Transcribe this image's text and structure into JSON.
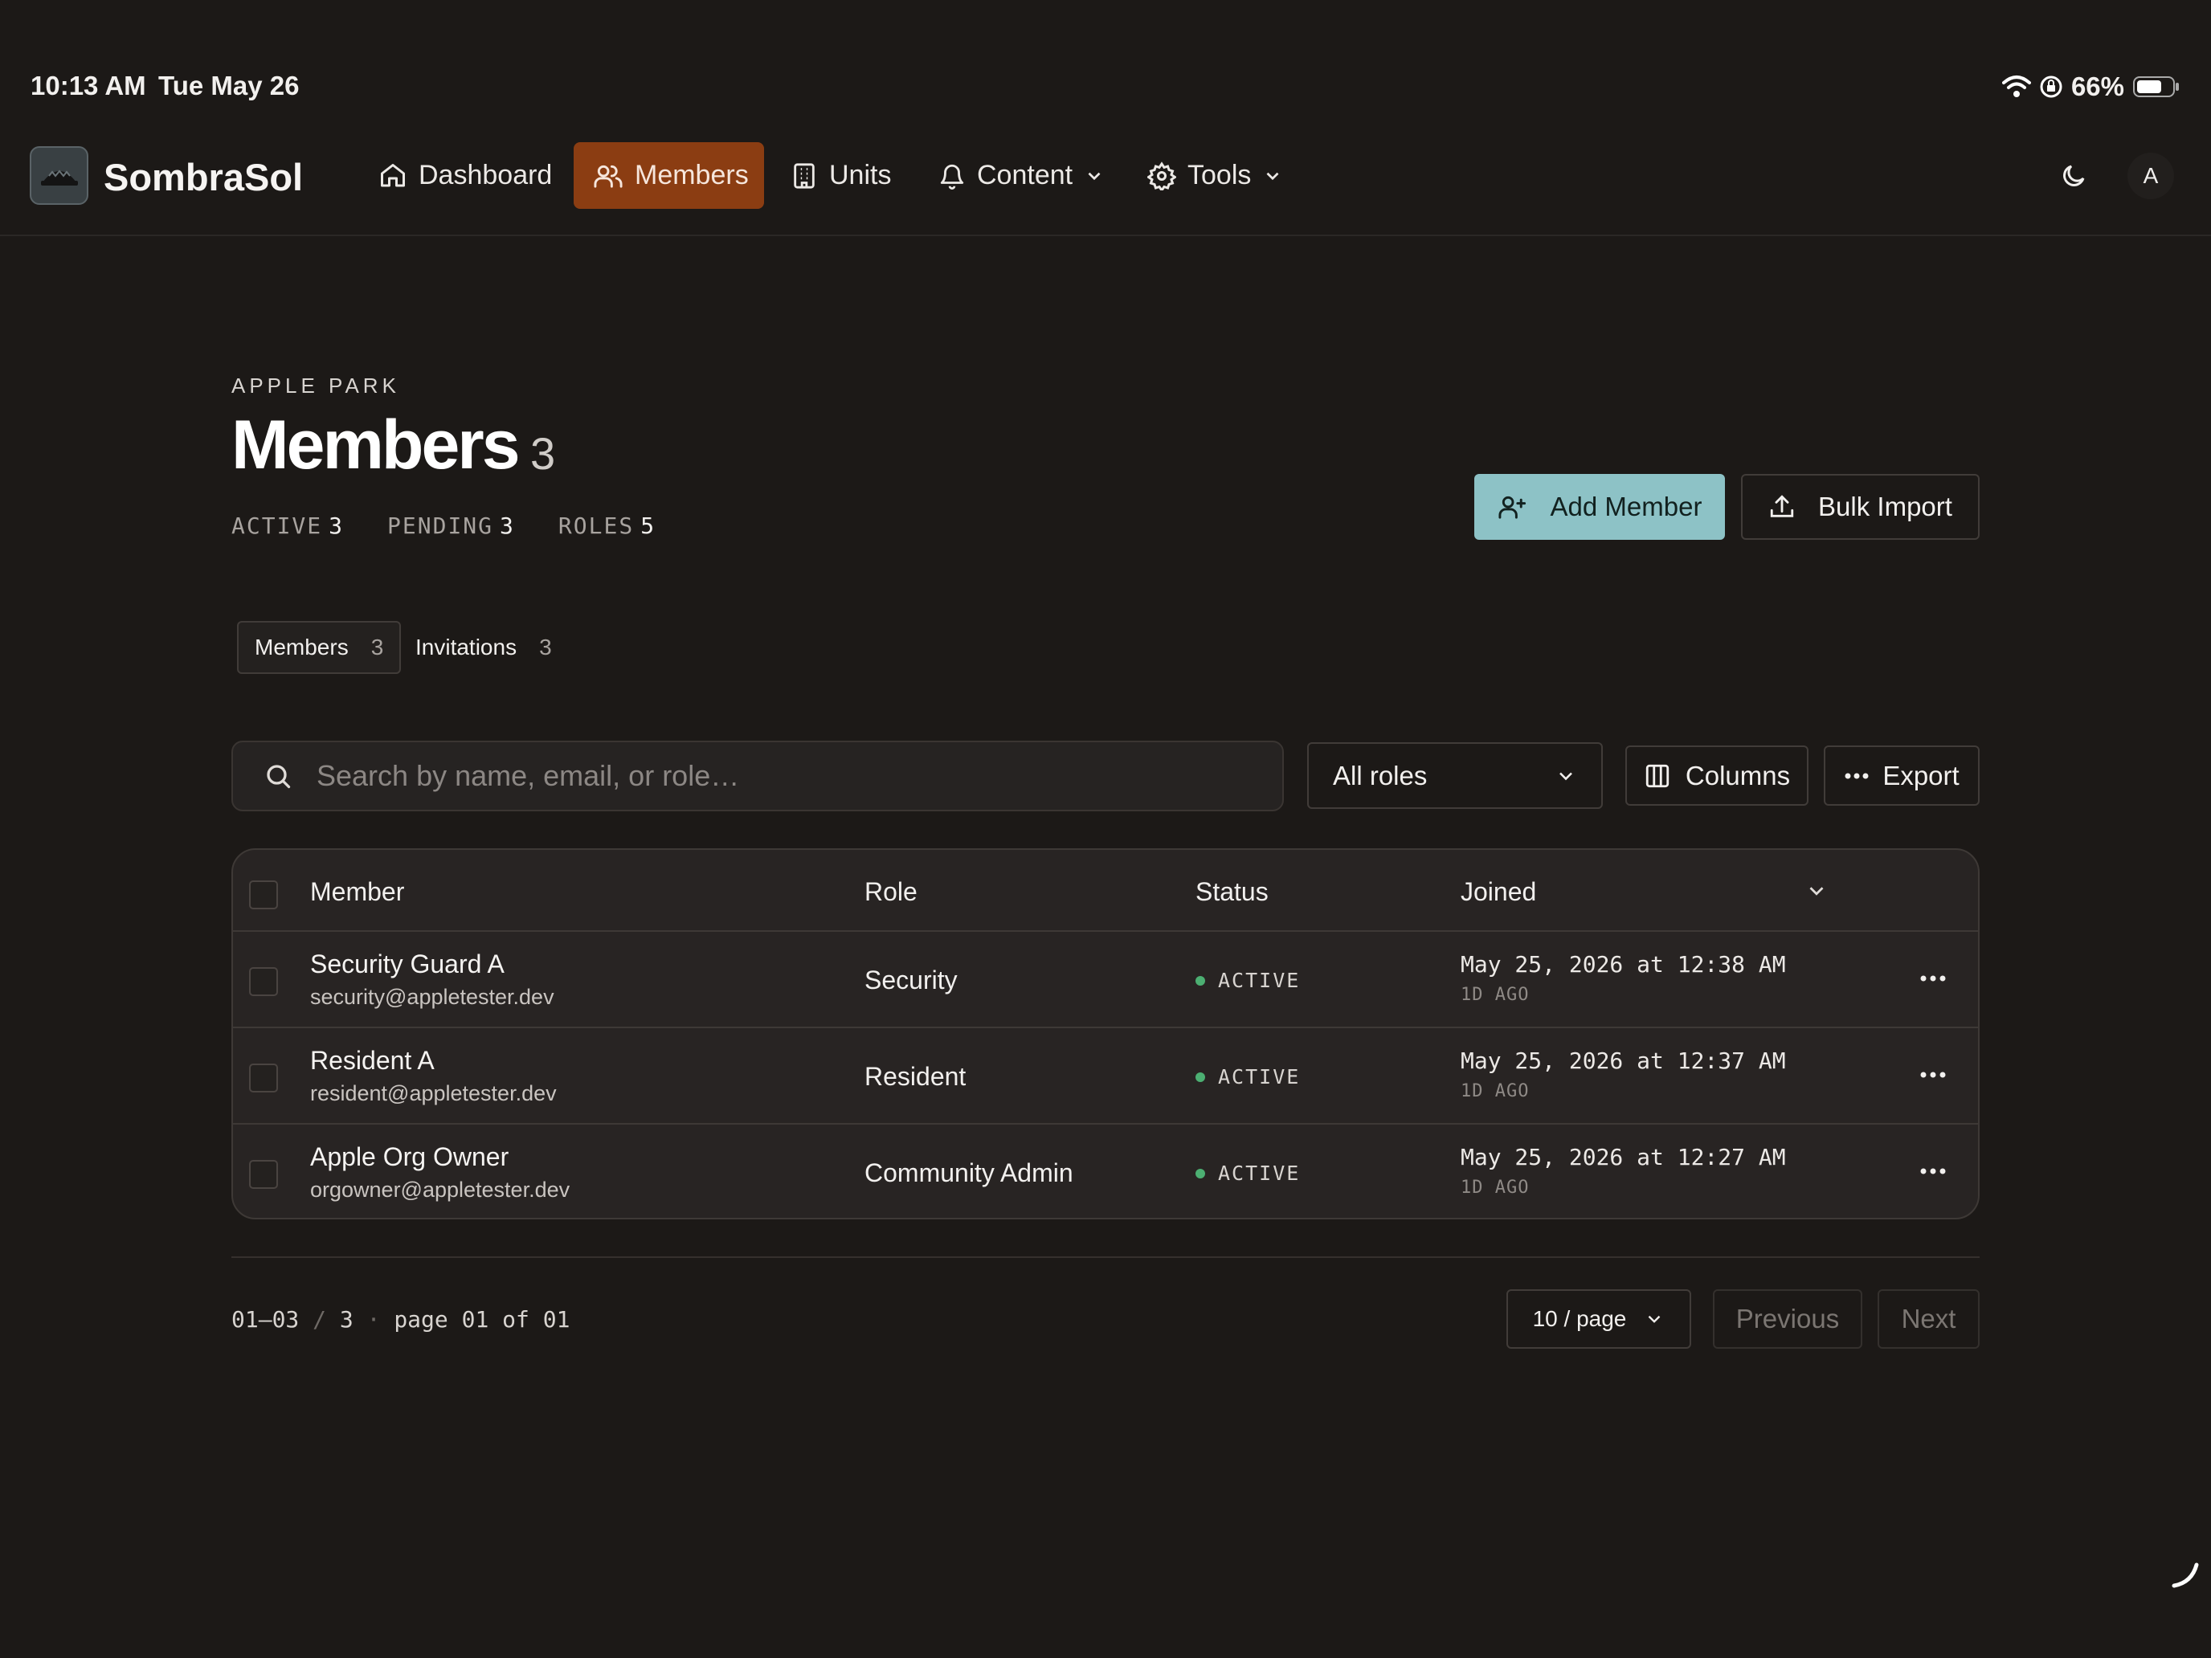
{
  "status_bar": {
    "time": "10:13 AM",
    "date": "Tue May 26",
    "battery": "66%"
  },
  "nav": {
    "brand": "SombraSol",
    "items": [
      {
        "label": "Dashboard",
        "icon": "home-icon"
      },
      {
        "label": "Members",
        "icon": "users-icon",
        "active": true
      },
      {
        "label": "Units",
        "icon": "building-icon"
      },
      {
        "label": "Content",
        "icon": "bell-icon",
        "has_dropdown": true
      },
      {
        "label": "Tools",
        "icon": "gear-icon",
        "has_dropdown": true
      }
    ],
    "avatar_initial": "A"
  },
  "header": {
    "eyebrow": "APPLE PARK",
    "title": "Members",
    "count": "3",
    "stats": [
      {
        "label": "ACTIVE",
        "value": "3"
      },
      {
        "label": "PENDING",
        "value": "3"
      },
      {
        "label": "ROLES",
        "value": "5"
      }
    ],
    "add_member_label": "Add Member",
    "bulk_import_label": "Bulk Import"
  },
  "tabs": [
    {
      "label": "Members",
      "count": "3",
      "active": true
    },
    {
      "label": "Invitations",
      "count": "3"
    }
  ],
  "toolbar": {
    "search_placeholder": "Search by name, email, or role…",
    "role_filter": "All roles",
    "columns_label": "Columns",
    "export_label": "Export"
  },
  "table": {
    "columns": [
      "Member",
      "Role",
      "Status",
      "Joined"
    ],
    "rows": [
      {
        "name": "Security Guard A",
        "email": "security@appletester.dev",
        "role": "Security",
        "status": "ACTIVE",
        "joined": "May 25, 2026 at 12:38 AM",
        "ago": "1D AGO"
      },
      {
        "name": "Resident A",
        "email": "resident@appletester.dev",
        "role": "Resident",
        "status": "ACTIVE",
        "joined": "May 25, 2026 at 12:37 AM",
        "ago": "1D AGO"
      },
      {
        "name": "Apple Org Owner",
        "email": "orgowner@appletester.dev",
        "role": "Community Admin",
        "status": "ACTIVE",
        "joined": "May 25, 2026 at 12:27 AM",
        "ago": "1D AGO"
      }
    ]
  },
  "pagination": {
    "range": "01–03",
    "total": "3",
    "page_text": "page 01 of 01",
    "per_page": "10 / page",
    "previous_label": "Previous",
    "next_label": "Next"
  },
  "colors": {
    "background": "#1c1917",
    "accent_nav": "#8b3d12",
    "primary_button": "#8dc2c6",
    "status_active": "#4caf72"
  }
}
